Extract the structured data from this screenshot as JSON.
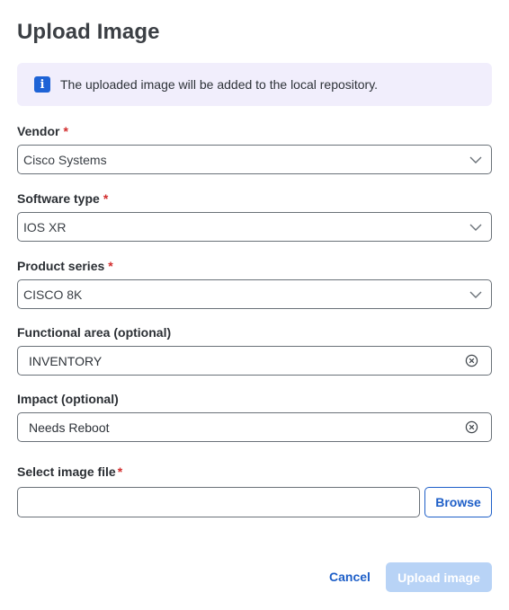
{
  "dialog": {
    "title": "Upload Image",
    "info": {
      "icon": "info-icon",
      "text": "The uploaded image will be added to the local repository."
    },
    "vendor": {
      "label": "Vendor",
      "required": "*",
      "value": "Cisco Systems"
    },
    "software_type": {
      "label": "Software type",
      "required": "*",
      "value": "IOS XR"
    },
    "product_series": {
      "label": "Product series",
      "required": "*",
      "value": "CISCO 8K"
    },
    "functional_area": {
      "label": "Functional area (optional)",
      "value": "INVENTORY"
    },
    "impact": {
      "label": "Impact (optional)",
      "value": "Needs Reboot"
    },
    "image_file": {
      "label": "Select image file",
      "required": "*",
      "value": "",
      "browse_label": "Browse"
    },
    "footer": {
      "cancel_label": "Cancel",
      "upload_label": "Upload image"
    }
  },
  "colors": {
    "accent": "#1e5fc8",
    "required": "#d22d2d",
    "banner_bg": "#f1eefc",
    "upload_disabled_bg": "#b8d3f6"
  }
}
